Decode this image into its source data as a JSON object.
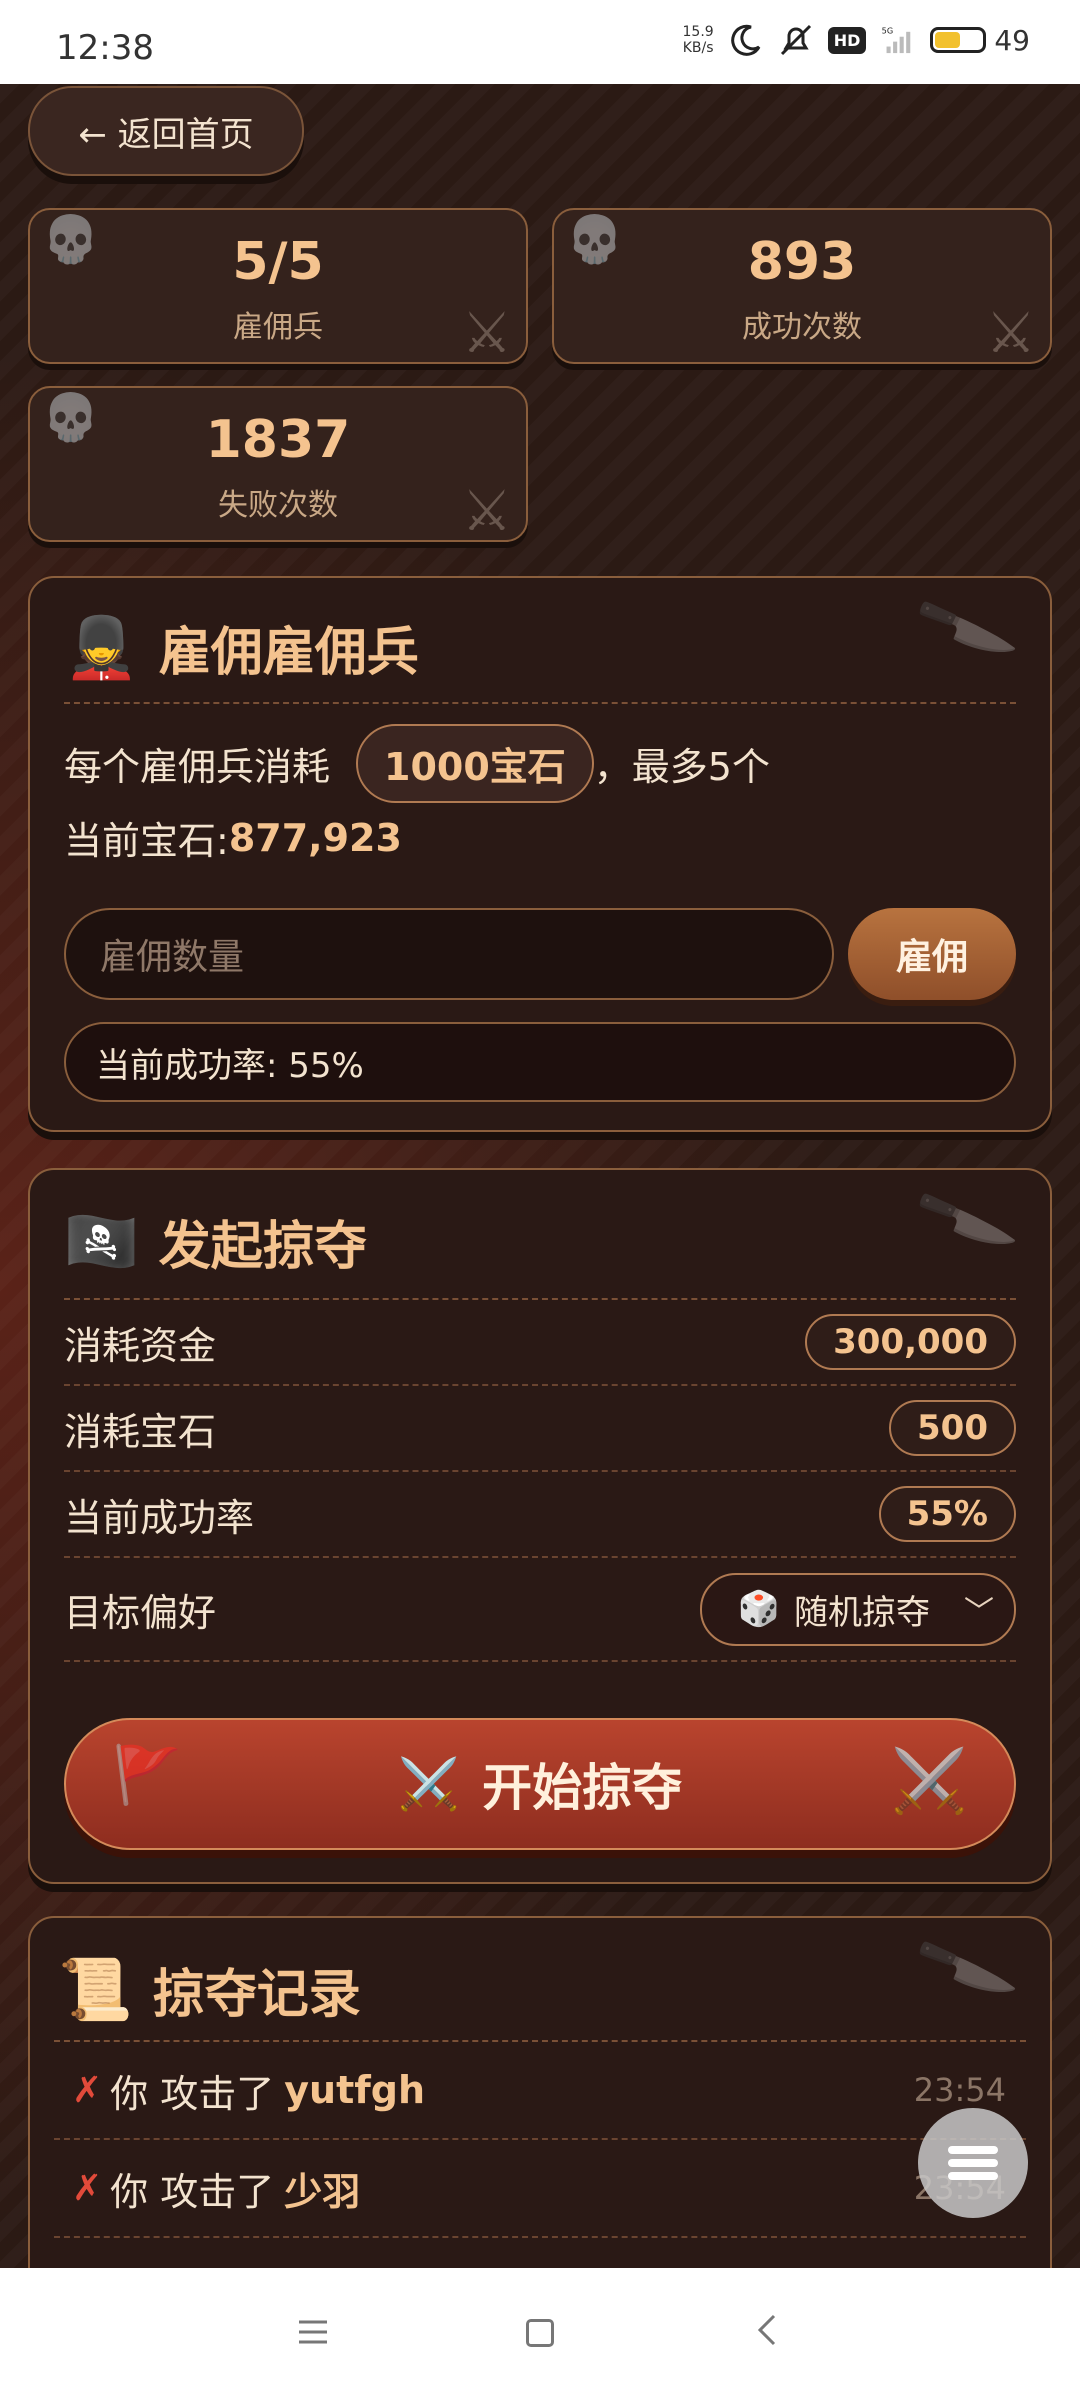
{
  "status_bar": {
    "time": "12:38",
    "net_speed_value": "15.9",
    "net_speed_unit": "KB/s",
    "hd": "HD",
    "signal_label": "5G",
    "battery_percent": "49",
    "battery_level": 0.49,
    "icons": [
      "moon-icon",
      "mute-icon",
      "hd-icon",
      "signal-icon",
      "battery-icon"
    ]
  },
  "header": {
    "back_label": "← 返回首页"
  },
  "stats": [
    {
      "value": "5/5",
      "label": "雇佣兵"
    },
    {
      "value": "893",
      "label": "成功次数"
    },
    {
      "value": "1837",
      "label": "失败次数"
    }
  ],
  "hire_panel": {
    "icon": "💂",
    "title": "雇佣雇佣兵",
    "cost_prefix": "每个雇佣兵消耗",
    "cost_pill": "1000宝石",
    "cost_suffix": "，最多5个",
    "gem_label": "当前宝石: ",
    "gem_value": "877,923",
    "input_placeholder": "雇佣数量",
    "hire_button": "雇佣",
    "success_rate_label": "当前成功率: 55%"
  },
  "raid_panel": {
    "icon": "🏴‍☠️",
    "title": "发起掠夺",
    "rows": [
      {
        "key": "消耗资金",
        "value": "300,000"
      },
      {
        "key": "消耗宝石",
        "value": "500"
      },
      {
        "key": "当前成功率",
        "value": "55%"
      }
    ],
    "target_label": "目标偏好",
    "target_option_icon": "🎲",
    "target_option": "随机掠夺",
    "start_button_icon": "⚔️",
    "start_button": "开始掠夺"
  },
  "log_panel": {
    "icon": "📜",
    "title": "掠夺记录",
    "entries": [
      {
        "mark": "✗",
        "text": "你 攻击了",
        "name": "yutfgh",
        "time": "23:54"
      },
      {
        "mark": "✗",
        "text": "你 攻击了",
        "name": "少羽",
        "time": "23:54"
      }
    ]
  },
  "colors": {
    "background": "#2b1a14",
    "accent": "#f4c38f",
    "border": "#8a5e3c",
    "raid_button": "#b9442e",
    "hire_button": "#b8733f"
  }
}
